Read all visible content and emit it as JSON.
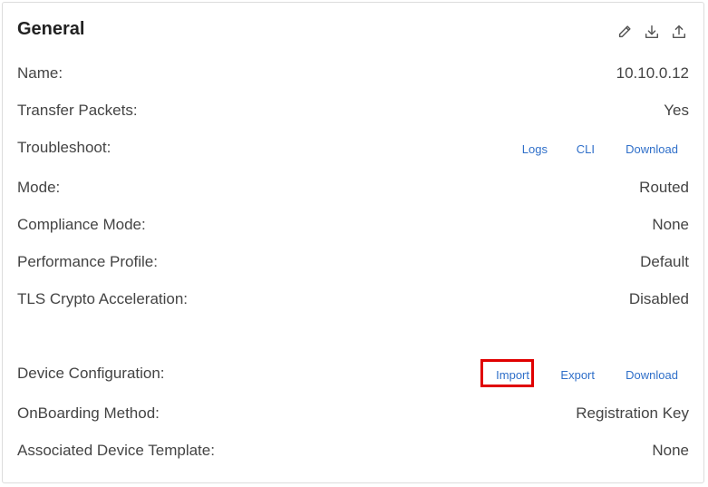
{
  "card": {
    "title": "General",
    "icons": [
      "edit-icon",
      "download-icon",
      "upload-icon"
    ]
  },
  "rows": {
    "name": {
      "label": "Name:",
      "value": "10.10.0.12"
    },
    "transfer_packets": {
      "label": "Transfer Packets:",
      "value": "Yes"
    },
    "troubleshoot": {
      "label": "Troubleshoot:",
      "links": {
        "logs": "Logs",
        "cli": "CLI",
        "download": "Download"
      }
    },
    "mode": {
      "label": "Mode:",
      "value": "Routed"
    },
    "compliance_mode": {
      "label": "Compliance Mode:",
      "value": "None"
    },
    "performance_profile": {
      "label": "Performance Profile:",
      "value": "Default"
    },
    "tls_crypto": {
      "label": "TLS Crypto Acceleration:",
      "value": "Disabled"
    },
    "device_configuration": {
      "label": "Device Configuration:",
      "links": {
        "import": "Import",
        "export": "Export",
        "download": "Download"
      }
    },
    "onboarding_method": {
      "label": "OnBoarding Method:",
      "value": "Registration Key"
    },
    "associated_template": {
      "label": "Associated Device Template:",
      "value": "None"
    }
  },
  "colors": {
    "link": "#2f6fc9",
    "highlight": "#e00000",
    "text": "#444444"
  }
}
